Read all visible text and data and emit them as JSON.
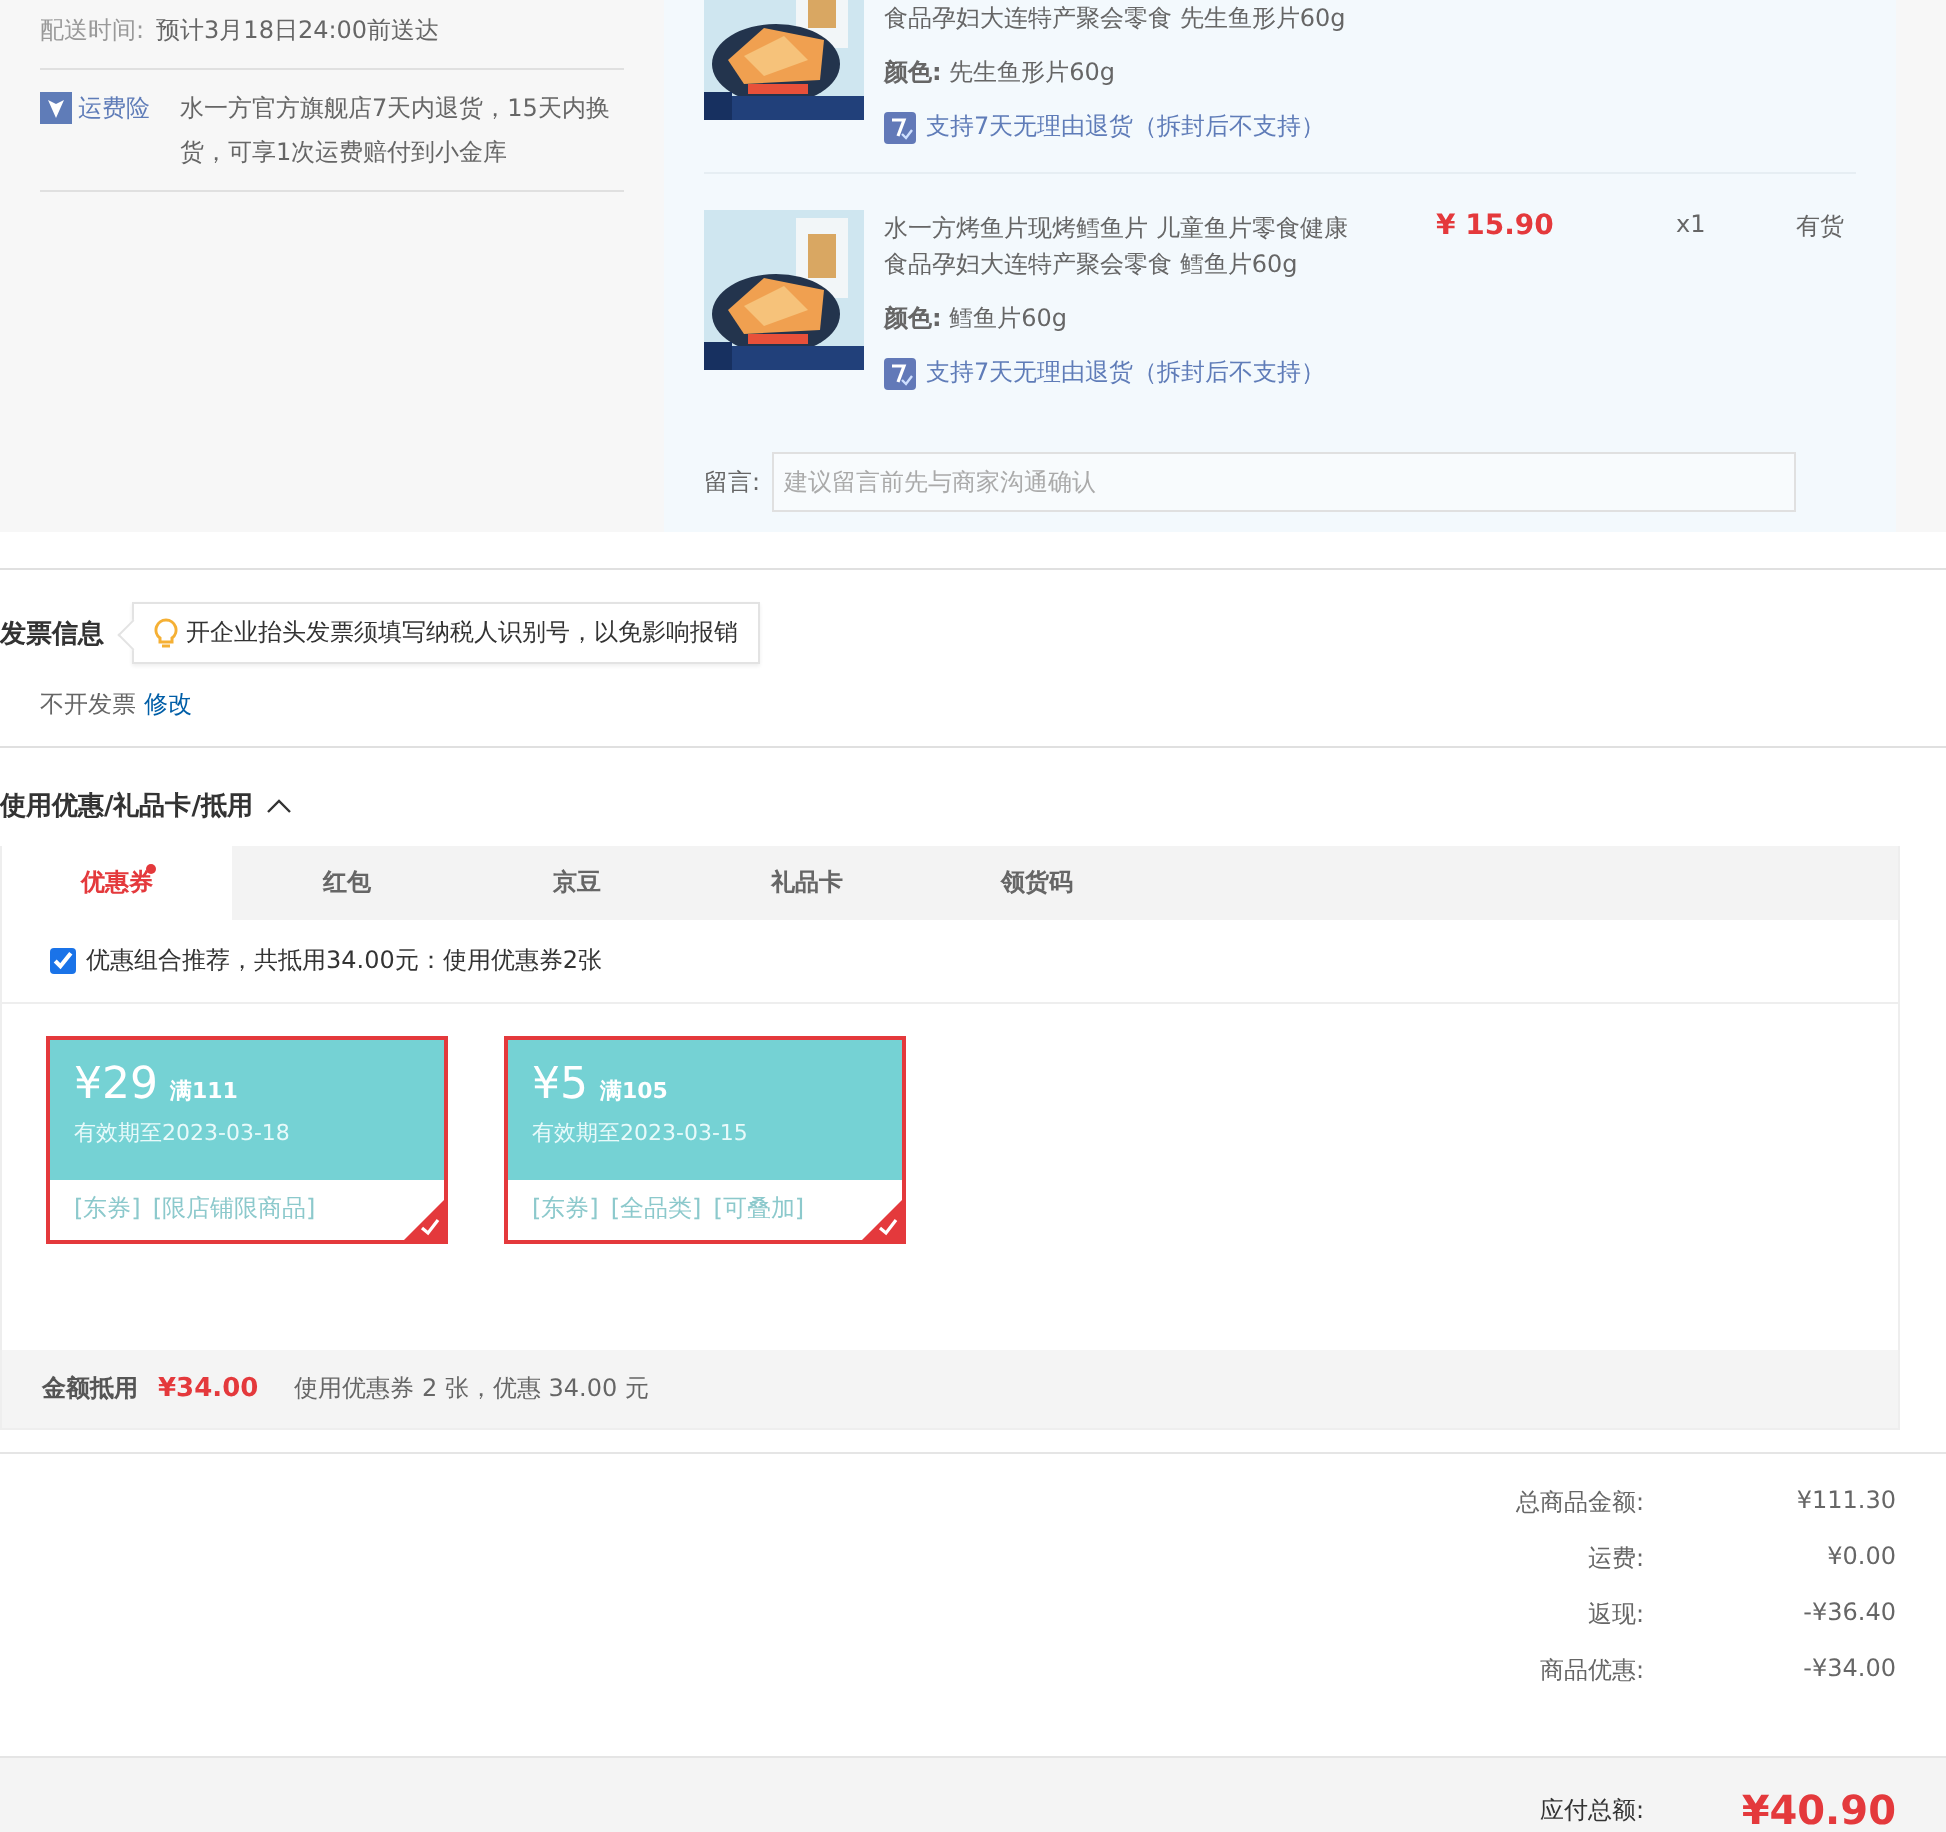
{
  "delivery": {
    "label": "配送时间:",
    "value": "预计3月18日24:00前送达"
  },
  "insurance": {
    "label": "运费险",
    "text": "水一方官方旗舰店7天内退货，15天内换货，可享1次运费赔付到小金库"
  },
  "products": [
    {
      "title": "食品孕妇大连特产聚会零食 先生鱼形片60g",
      "color_label": "颜色:",
      "variant": "先生鱼形片60g",
      "policy": "支持7天无理由退货（拆封后不支持）"
    },
    {
      "title": "水一方烤鱼片现烤鳕鱼片 儿童鱼片零食健康食品孕妇大连特产聚会零食 鳕鱼片60g",
      "color_label": "颜色:",
      "variant": "鳕鱼片60g",
      "policy": "支持7天无理由退货（拆封后不支持）",
      "price": "¥ 15.90",
      "qty": "x1",
      "stock": "有货"
    }
  ],
  "message": {
    "label": "留言:",
    "placeholder": "建议留言前先与商家沟通确认"
  },
  "invoice": {
    "heading": "发票信息",
    "tip": "开企业抬头发票须填写纳税人识别号，以免影响报销",
    "value": "不开发票",
    "link": "修改"
  },
  "discounts": {
    "heading": "使用优惠/礼品卡/抵用",
    "expanded": true,
    "tabs": [
      {
        "label": "优惠券",
        "selected": true,
        "dot": true
      },
      {
        "label": "红包",
        "selected": false,
        "dot": false
      },
      {
        "label": "京豆",
        "selected": false,
        "dot": false
      },
      {
        "label": "礼品卡",
        "selected": false,
        "dot": false
      },
      {
        "label": "领货码",
        "selected": false,
        "dot": false
      }
    ],
    "recommend": {
      "checked": true,
      "text": "优惠组合推荐，共抵用34.00元：使用优惠券2张"
    },
    "coupons": [
      {
        "amount": "¥29",
        "condition": "满111",
        "validity": "有效期至2023-03-18",
        "tags": [
          "[东券]",
          "[限店铺限商品]"
        ],
        "selected": true
      },
      {
        "amount": "¥5",
        "condition": "满105",
        "validity": "有效期至2023-03-15",
        "tags": [
          "[东券]",
          "[全品类]",
          "[可叠加]"
        ],
        "selected": true
      }
    ],
    "summary": {
      "label": "金额抵用",
      "amount": "¥34.00",
      "text": "使用优惠券 2 张，优惠 34.00 元"
    }
  },
  "totals": {
    "rows": [
      {
        "label": "总商品金额:",
        "value": "¥111.30"
      },
      {
        "label": "运费:",
        "value": "¥0.00"
      },
      {
        "label": "返现:",
        "value": "-¥36.40"
      },
      {
        "label": "商品优惠:",
        "value": "-¥34.00"
      }
    ],
    "payable": {
      "label": "应付总额:",
      "value": "¥40.90"
    }
  }
}
